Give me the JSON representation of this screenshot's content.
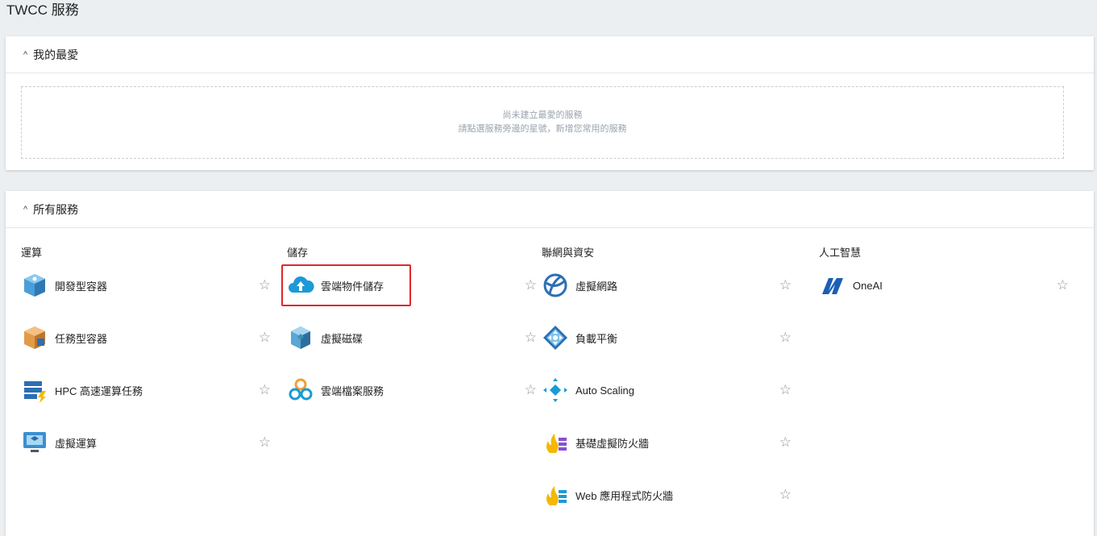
{
  "page": {
    "title": "TWCC 服務"
  },
  "favorites": {
    "title": "我的最愛",
    "empty_line1": "尚未建立最愛的服務",
    "empty_line2": "請點選服務旁邊的星號，新增您常用的服務"
  },
  "all": {
    "title": "所有服務",
    "categories": [
      {
        "title": "運算",
        "items": [
          {
            "label": "開發型容器",
            "icon": "dev-container-icon"
          },
          {
            "label": "任務型容器",
            "icon": "job-container-icon"
          },
          {
            "label": "HPC 高速運算任務",
            "icon": "hpc-icon"
          },
          {
            "label": "虛擬運算",
            "icon": "virtual-compute-icon"
          }
        ]
      },
      {
        "title": "儲存",
        "items": [
          {
            "label": "雲端物件儲存",
            "icon": "cloud-upload-icon",
            "highlighted": true
          },
          {
            "label": "虛擬磁碟",
            "icon": "virtual-disk-icon"
          },
          {
            "label": "雲端檔案服務",
            "icon": "cloud-file-icon"
          }
        ]
      },
      {
        "title": "聯網與資安",
        "items": [
          {
            "label": "虛擬網路",
            "icon": "virtual-network-icon"
          },
          {
            "label": "負載平衡",
            "icon": "load-balancer-icon"
          },
          {
            "label": "Auto Scaling",
            "icon": "auto-scaling-icon"
          },
          {
            "label": "基礎虛擬防火牆",
            "icon": "firewall-icon"
          },
          {
            "label": "Web 應用程式防火牆",
            "icon": "waf-icon"
          }
        ]
      },
      {
        "title": "人工智慧",
        "items": [
          {
            "label": "OneAI",
            "icon": "oneai-icon"
          }
        ]
      }
    ]
  },
  "star_glyph": "☆",
  "caret_glyph": "^",
  "colors": {
    "highlight": "#e0262b",
    "accent": "#1b9ad6"
  }
}
